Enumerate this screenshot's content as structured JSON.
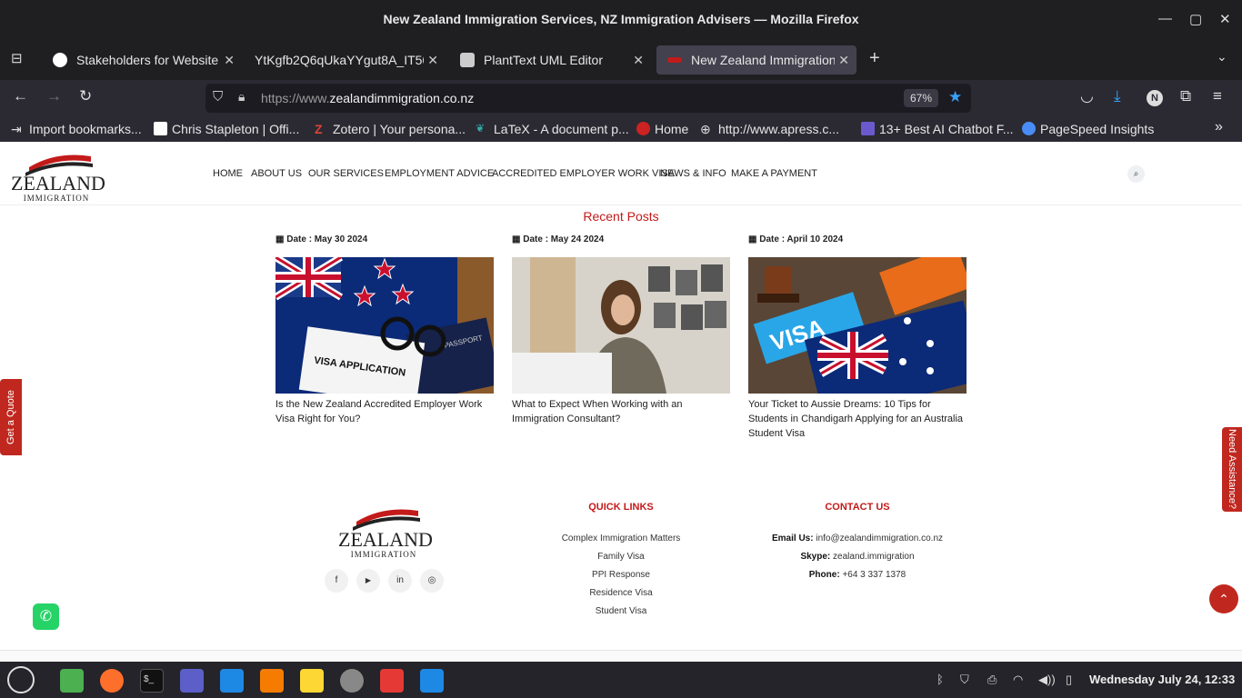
{
  "window": {
    "title": "New Zealand Immigration Services, NZ Immigration Advisers — Mozilla Firefox"
  },
  "tabs": [
    {
      "label": "Stakeholders for Website",
      "active": false
    },
    {
      "label": "YtKgfb2Q6qUkaYYgut8A_IT50",
      "active": false
    },
    {
      "label": "PlantText UML Editor",
      "active": false
    },
    {
      "label": "New Zealand Immigration S",
      "active": true
    }
  ],
  "urlbar": {
    "prefix": "https://www.",
    "domain": "zealandimmigration.co.nz",
    "zoom": "67%"
  },
  "bookmarks": [
    "Import bookmarks...",
    "Chris Stapleton | Offi...",
    "Zotero | Your persona...",
    "LaTeX - A document p...",
    "Home",
    "http://www.apress.c...",
    "13+ Best AI Chatbot F...",
    "PageSpeed Insights"
  ],
  "site": {
    "logo": {
      "main": "ZEALAND",
      "sub": "IMMIGRATION"
    },
    "menu": [
      "HOME",
      "ABOUT US",
      "OUR SERVICES",
      "EMPLOYMENT ADVICE",
      "ACCREDITED EMPLOYER WORK VISA",
      "NEWS & INFO",
      "MAKE A PAYMENT"
    ],
    "recent_heading": "Recent Posts",
    "posts": [
      {
        "date": "Date : May 30 2024",
        "title": "Is the New Zealand Accredited Employer Work Visa Right for You?",
        "img_text_1": "VISA APPLICATION",
        "img_text_2": "PASSPORT"
      },
      {
        "date": "Date : May 24 2024",
        "title": "What to Expect When Working with an Immigration Consultant?"
      },
      {
        "date": "Date : April 10 2024",
        "title": "Your Ticket to Aussie Dreams: 10 Tips for Students in Chandigarh Applying for an Australia Student Visa",
        "img_text_1": "VISA"
      }
    ],
    "side_left": "Get a Quote",
    "side_right": "Need Assistance?",
    "footer": {
      "quick_title": "QUICK LINKS",
      "quick_links": [
        "Complex Immigration Matters",
        "Family Visa",
        "PPI Response",
        "Residence Visa",
        "Student Visa"
      ],
      "contact_title": "CONTACT US",
      "email_label": "Email Us:",
      "email": "info@zealandimmigration.co.nz",
      "skype_label": "Skype:",
      "skype": "zealand.immigration",
      "phone_label": "Phone:",
      "phone": "+64 3 337 1378",
      "social": [
        "f",
        "▶",
        "in",
        "◎"
      ]
    }
  },
  "taskbar": {
    "clock": "Wednesday July 24, 12:33"
  },
  "colors": {
    "brand_red": "#c31a1a",
    "chrome_dark": "#1f1f22",
    "whatsapp": "#25d366"
  }
}
